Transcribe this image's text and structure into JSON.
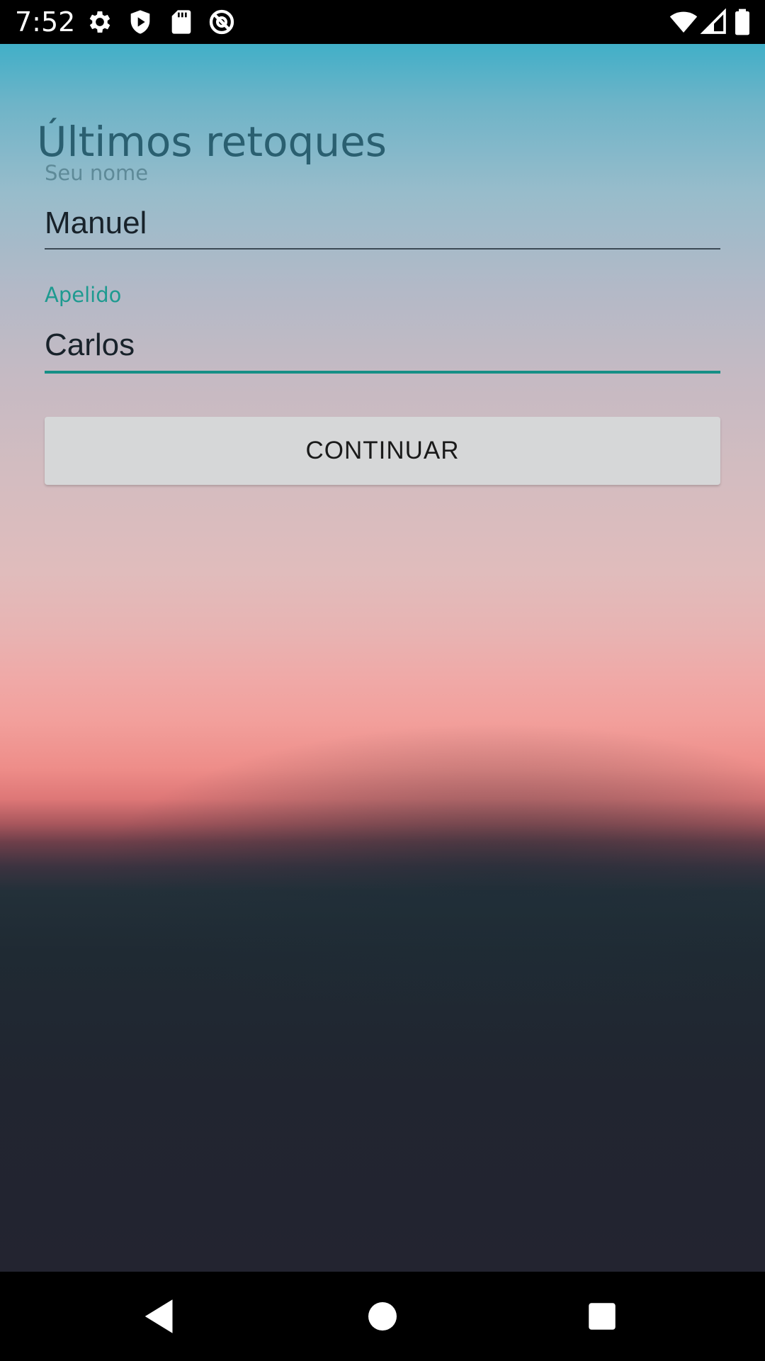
{
  "status_bar": {
    "time": "7:52",
    "left_icons": [
      "gear-icon",
      "play-shield-icon",
      "sd-card-icon",
      "no-location-icon"
    ],
    "right_icons": [
      "wifi-icon",
      "cell-signal-icon",
      "battery-icon"
    ]
  },
  "screen": {
    "title": "Últimos retoques",
    "fields": [
      {
        "label": "Seu nome",
        "value": "Manuel"
      },
      {
        "label": "Apelido",
        "value": "Carlos"
      }
    ],
    "continue_label": "CONTINUAR"
  },
  "colors": {
    "title": "#2a5f70",
    "focused_accent": "#168f86",
    "button_background": "#d6d7d8"
  },
  "nav_bar": {
    "buttons": [
      "back-icon",
      "home-icon",
      "recents-icon"
    ]
  }
}
